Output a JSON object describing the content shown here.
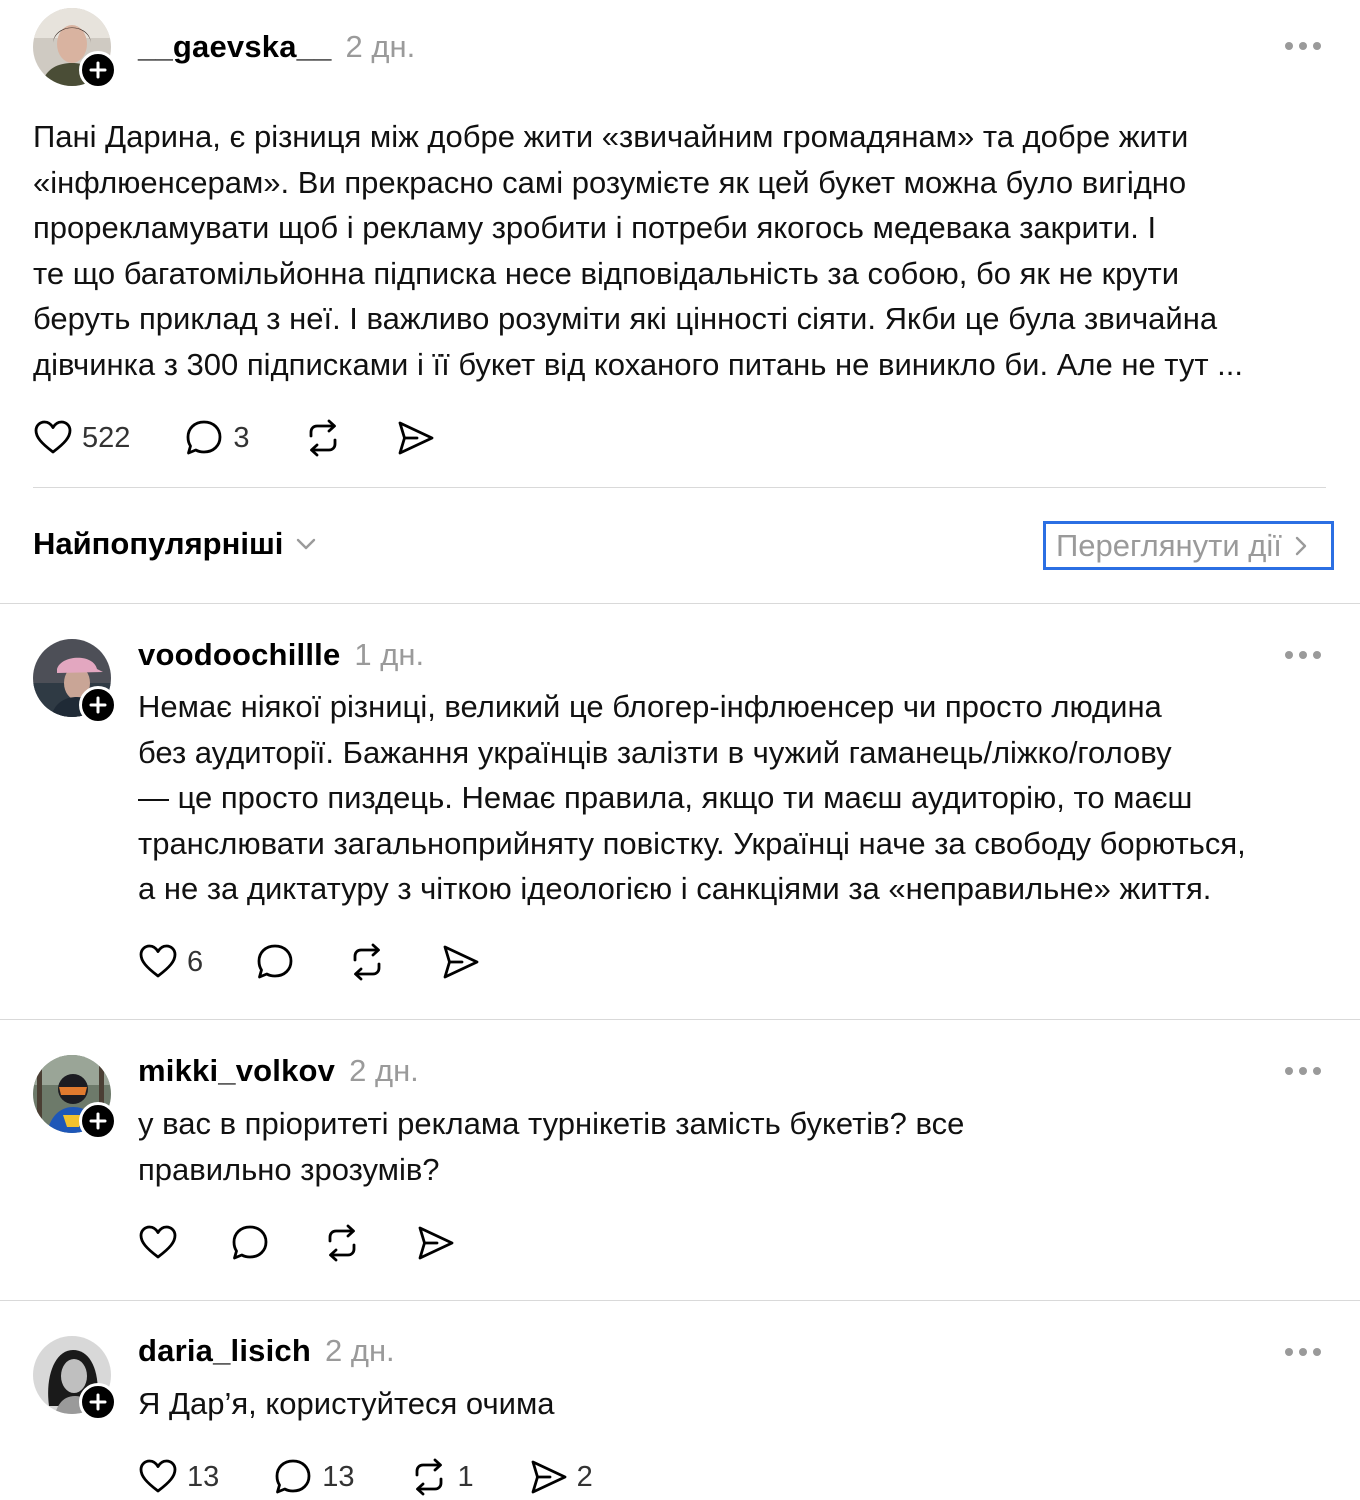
{
  "post": {
    "username": "__gaevska__",
    "time": "2 дн.",
    "lines": [
      "Пані Дарина, є різниця між добре жити «звичайним громадянам» та добре жити",
      "«інфлюенсерам». Ви прекрасно самі розумієте як цей букет можна було вигідно",
      "прорекламувати щоб і рекламу зробити і потреби якогось медевака закрити. І",
      "те що багатомільйонна підписка несе відповідальність за собою, бо як не крути",
      "беруть приклад з неї. І важливо розуміти які цінності сіяти. Якби це була звичайна",
      "дівчинка з 300 підписками і її букет від коханого питань не виникло би. Але не тут ..."
    ],
    "likes": "522",
    "comments": "3"
  },
  "sort": {
    "label": "Найпопулярніші",
    "view_activity": "Переглянути дії"
  },
  "replies": [
    {
      "username": "voodoochillle",
      "time": "1 дн.",
      "lines": [
        "Немає ніякої різниці, великий це блогер-інфлюенсер чи просто людина",
        "без аудиторії. Бажання українців залізти в чужий гаманець/ліжко/голову",
        "— це просто пиздець. Немає правила, якщо ти маєш аудиторію, то маєш",
        "транслювати загальноприйняту повістку. Українці наче за свободу борються,",
        "а не за диктатуру з чіткою ідеологією і санкціями за «неправильне» життя."
      ],
      "likes": "6",
      "comments": "",
      "reposts": "",
      "shares": ""
    },
    {
      "username": "mikki_volkov",
      "time": "2 дн.",
      "lines": [
        "у вас в пріоритеті реклама турнікетів замість букетів? все",
        "правильно зрозумів?"
      ],
      "likes": "",
      "comments": "",
      "reposts": "",
      "shares": ""
    },
    {
      "username": "daria_lisich",
      "time": "2 дн.",
      "lines": [
        "Я Дар’я, користуйтеся очима"
      ],
      "likes": "13",
      "comments": "13",
      "reposts": "1",
      "shares": "2"
    }
  ],
  "icons": {
    "like": "heart-icon",
    "comment": "comment-bubble-icon",
    "repost": "repost-icon",
    "share": "send-icon",
    "more": "more-dots-icon",
    "follow": "plus-icon",
    "sort_chevron": "chevron-down-icon",
    "view_chevron": "chevron-right-icon"
  },
  "colors": {
    "accent_border": "#2b6fe3",
    "muted_text": "#9a9a9a",
    "divider": "#d9d9d9"
  }
}
